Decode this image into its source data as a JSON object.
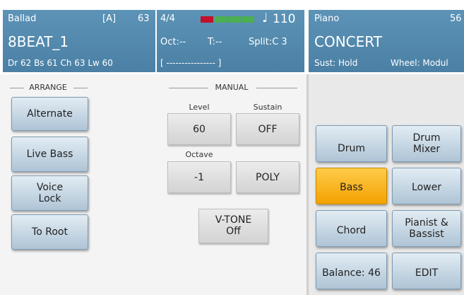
{
  "style_panel": {
    "style_name": "Ballad",
    "variation": "[A]",
    "number": "63",
    "title": "8BEAT_1",
    "channels": "Dr 62  Bs 61  Ch 63  Lw 60"
  },
  "center_panel": {
    "time_signature": "4/4",
    "tempo": "110",
    "octave": "Oct:--",
    "transpose": "T:--",
    "split": "Split:C 3",
    "chord_display": "[ ---------------- ]",
    "beat_indicator": [
      "#c2112a",
      "#4caf50",
      "#4caf50",
      "#4caf50"
    ]
  },
  "voice_panel": {
    "category": "Piano",
    "number": "56",
    "name": "CONCERT",
    "sustain": "Sust: Hold",
    "wheel": "Wheel: Modul"
  },
  "arrange": {
    "label": "ARRANGE",
    "buttons": [
      "Alternate",
      "Live Bass",
      "Voice Lock",
      "To Root"
    ]
  },
  "manual": {
    "label": "MANUAL",
    "level_label": "Level",
    "level_value": "60",
    "sustain_label": "Sustain",
    "sustain_value": "OFF",
    "octave_label": "Octave",
    "octave_value": "-1",
    "poly_value": "POLY",
    "vtone_line1": "V-TONE",
    "vtone_line2": "Off"
  },
  "parts": {
    "drum": "Drum",
    "drum_mixer_1": "Drum",
    "drum_mixer_2": "Mixer",
    "bass": "Bass",
    "lower": "Lower",
    "chord": "Chord",
    "pianist_1": "Pianist &",
    "pianist_2": "Bassist",
    "balance": "Balance: 46",
    "edit": "EDIT",
    "active": "bass"
  },
  "colors": {
    "header_blue": "#4f86aa",
    "active_orange": "#f5a800"
  }
}
